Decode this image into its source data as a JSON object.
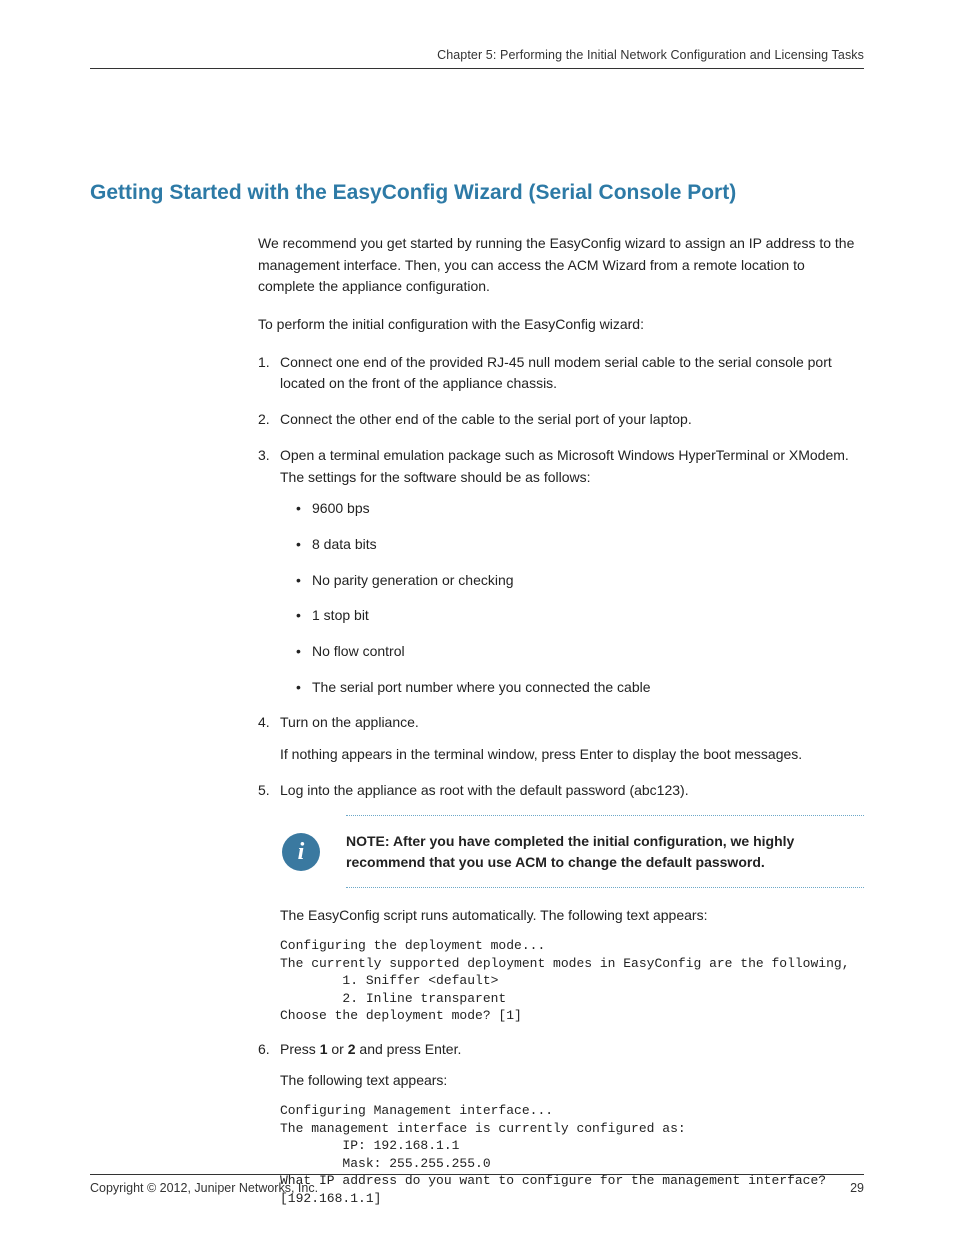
{
  "header": {
    "chapter": "Chapter 5: Performing the Initial Network Configuration and Licensing Tasks"
  },
  "section": {
    "title": "Getting Started with the EasyConfig Wizard (Serial Console Port)",
    "intro_p1": "We recommend you get started by running the EasyConfig wizard to assign an IP address to the management interface. Then, you can access the ACM Wizard from a remote location to complete the appliance configuration.",
    "intro_p2": "To perform the initial configuration with the EasyConfig wizard:"
  },
  "steps": {
    "s1": "Connect one end of the provided RJ-45 null modem serial cable to the serial console port located on the front of the appliance chassis.",
    "s2": "Connect the other end of the cable to the serial port of your laptop.",
    "s3": "Open a terminal emulation package such as Microsoft Windows HyperTerminal or XModem. The settings for the software should be as follows:",
    "s3_bullets": {
      "b1": "9600 bps",
      "b2": "8 data bits",
      "b3": "No parity generation or checking",
      "b4": "1 stop bit",
      "b5": "No flow control",
      "b6": "The serial port number where you connected the cable"
    },
    "s4": "Turn on the appliance.",
    "s4_sub": "If nothing appears in the terminal window, press Enter to display the boot messages.",
    "s5": "Log into the appliance as root with the default password (abc123).",
    "note_label": "NOTE:",
    "note_text": "After you have completed the initial configuration, we highly recommend that you use ACM to change the default password.",
    "s5_after": "The EasyConfig script runs automatically. The following text appears:",
    "code1": "Configuring the deployment mode...\nThe currently supported deployment modes in EasyConfig are the following,\n        1. Sniffer <default>\n        2. Inline transparent\nChoose the deployment mode? [1]",
    "s6_pre": "Press ",
    "s6_b1": "1",
    "s6_mid": " or ",
    "s6_b2": "2",
    "s6_post": " and press Enter.",
    "s6_sub": "The following text appears:",
    "code2": "Configuring Management interface...\nThe management interface is currently configured as:\n        IP: 192.168.1.1\n        Mask: 255.255.255.0\nWhat IP address do you want to configure for the management interface? \n[192.168.1.1]"
  },
  "footer": {
    "copyright": "Copyright © 2012, Juniper Networks, Inc.",
    "page": "29"
  }
}
